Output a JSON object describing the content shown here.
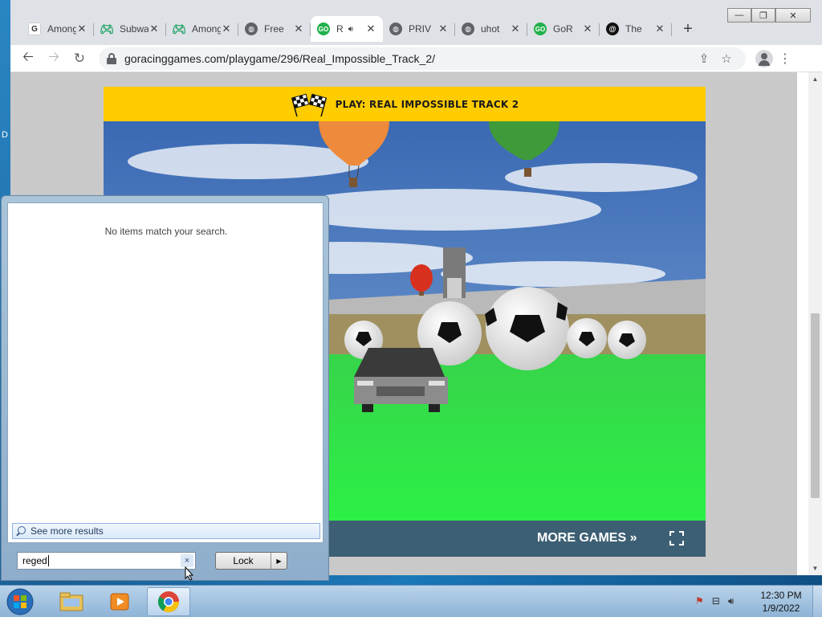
{
  "desktop": {
    "edge_letter": "D"
  },
  "browser": {
    "tabs": [
      {
        "title": "Among",
        "icon": "ga-icon"
      },
      {
        "title": "Subway",
        "icon": "gamepad-icon"
      },
      {
        "title": "Among",
        "icon": "gamepad-icon"
      },
      {
        "title": "Free",
        "icon": "globe-icon"
      },
      {
        "title": "R",
        "icon": "go-icon",
        "active": true,
        "audio": true
      },
      {
        "title": "PRIV",
        "icon": "globe-icon"
      },
      {
        "title": "uhot",
        "icon": "globe-icon"
      },
      {
        "title": "GoR",
        "icon": "go-icon"
      },
      {
        "title": "The",
        "icon": "threads-icon"
      }
    ],
    "new_tab_label": "+",
    "url": "goracinggames.com/playgame/296/Real_Impossible_Track_2/",
    "window_controls": {
      "minimize": "—",
      "maximize": "❐",
      "close": "✕"
    }
  },
  "page": {
    "header_title": "PLAY:  REAL IMPOSSIBLE TRACK 2",
    "more_games": "MORE GAMES »"
  },
  "start_menu": {
    "no_results": "No items match your search.",
    "see_more": "See more results",
    "search_value": "reged",
    "clear_label": "×",
    "lock_label": "Lock"
  },
  "taskbar": {
    "time": "12:30 PM",
    "date": "1/9/2022"
  },
  "colors": {
    "header_yellow": "#ffcc00",
    "footer_blue": "#3d5f74",
    "grass": "#2ee04a",
    "sky": "#3d6fb8"
  }
}
